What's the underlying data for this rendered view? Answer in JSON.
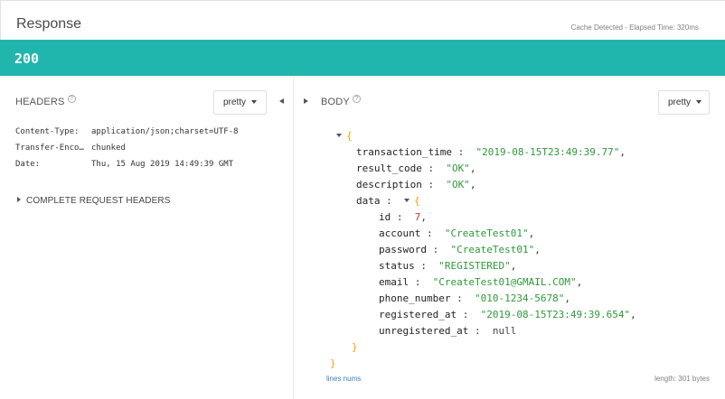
{
  "header": {
    "title": "Response",
    "cache_text": "Cache Detected - Elapsed Time: 320ms"
  },
  "status": {
    "code": "200"
  },
  "headers_panel": {
    "label": "HEADERS",
    "help_glyph": "?",
    "format": "pretty",
    "rows": [
      {
        "name": "Content-Type:",
        "value": "application/json;charset=UTF-8"
      },
      {
        "name": "Transfer-Enco…",
        "value": "chunked"
      },
      {
        "name": "Date:",
        "value": "Thu, 15 Aug 2019 14:49:39 GMT"
      }
    ],
    "complete_request_headers": "COMPLETE REQUEST HEADERS"
  },
  "body_panel": {
    "label": "BODY",
    "help_glyph": "?",
    "format": "pretty",
    "json": {
      "open_brace": "{",
      "close_brace": "}",
      "transaction_time_key": "transaction_time",
      "transaction_time_value": "\"2019-08-15T23:49:39.77\"",
      "result_code_key": "result_code",
      "result_code_value": "\"OK\"",
      "description_key": "description",
      "description_value": "\"OK\"",
      "data_key": "data",
      "data_open": "{",
      "data_close": "}",
      "data_fields": [
        {
          "key": "id",
          "value": "7",
          "type": "num"
        },
        {
          "key": "account",
          "value": "\"CreateTest01\"",
          "type": "str"
        },
        {
          "key": "password",
          "value": "\"CreateTest01\"",
          "type": "str"
        },
        {
          "key": "status",
          "value": "\"REGISTERED\"",
          "type": "str"
        },
        {
          "key": "email",
          "value": "\"CreateTest01@GMAIL.COM\"",
          "type": "str"
        },
        {
          "key": "phone_number",
          "value": "\"010-1234-5678\"",
          "type": "str"
        },
        {
          "key": "registered_at",
          "value": "\"2019-08-15T23:49:39.654\"",
          "type": "str"
        },
        {
          "key": "unregistered_at",
          "value": "null",
          "type": "null"
        }
      ]
    },
    "lines_nums": "lines nums",
    "length": "length: 301 bytes"
  }
}
